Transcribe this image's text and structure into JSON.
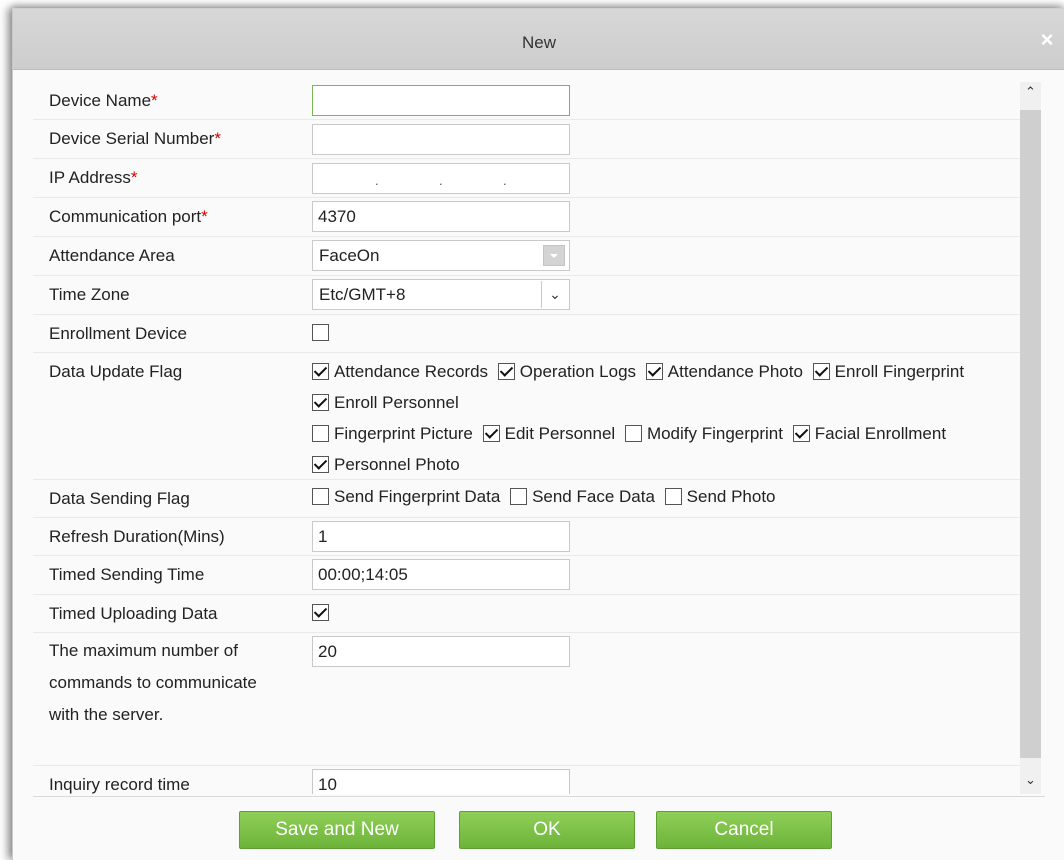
{
  "dialog": {
    "title": "New",
    "close_glyph": "×"
  },
  "required_mark": "*",
  "fields": {
    "device_name": {
      "label": "Device Name",
      "value": ""
    },
    "serial": {
      "label": "Device Serial Number",
      "value": ""
    },
    "ip": {
      "label": "IP Address",
      "sep": "."
    },
    "port": {
      "label": "Communication port",
      "value": "4370"
    },
    "area": {
      "label": "Attendance Area",
      "value": "FaceOn"
    },
    "timezone": {
      "label": "Time Zone",
      "value": "Etc/GMT+8"
    },
    "enroll_device": {
      "label": "Enrollment Device",
      "checked": false
    },
    "data_update": {
      "label": "Data Update Flag",
      "options": [
        {
          "label": "Attendance Records",
          "checked": true
        },
        {
          "label": "Operation Logs",
          "checked": true
        },
        {
          "label": "Attendance Photo",
          "checked": true
        },
        {
          "label": "Enroll Fingerprint",
          "checked": true
        },
        {
          "label": "Enroll Personnel",
          "checked": true
        },
        {
          "label": "Fingerprint Picture",
          "checked": false
        },
        {
          "label": "Edit Personnel",
          "checked": true
        },
        {
          "label": "Modify Fingerprint",
          "checked": false
        },
        {
          "label": "Facial Enrollment",
          "checked": true
        },
        {
          "label": "Personnel Photo",
          "checked": true
        }
      ]
    },
    "data_sending": {
      "label": "Data Sending Flag",
      "options": [
        {
          "label": "Send Fingerprint Data",
          "checked": false
        },
        {
          "label": "Send Face Data",
          "checked": false
        },
        {
          "label": "Send Photo",
          "checked": false
        }
      ]
    },
    "refresh": {
      "label": "Refresh Duration(Mins)",
      "value": "1"
    },
    "timed_sending": {
      "label": "Timed Sending Time",
      "value": "00:00;14:05"
    },
    "timed_upload": {
      "label": "Timed Uploading Data",
      "checked": true
    },
    "max_commands": {
      "label": "The maximum number of commands to communicate with the server.",
      "value": "20"
    },
    "inquiry": {
      "label": "Inquiry record time",
      "value": "10"
    }
  },
  "buttons": {
    "save_new": "Save and New",
    "ok": "OK",
    "cancel": "Cancel"
  },
  "icons": {
    "close": "close-icon",
    "dropdown": "chevron-down-icon",
    "scroll_up": "chevron-up-icon",
    "scroll_down": "chevron-down-icon",
    "check": "checkmark-icon"
  },
  "colors": {
    "button": "#7cc046",
    "required": "#d10000",
    "focus_border": "#7db255",
    "titlebar": "#d3d3d3"
  }
}
